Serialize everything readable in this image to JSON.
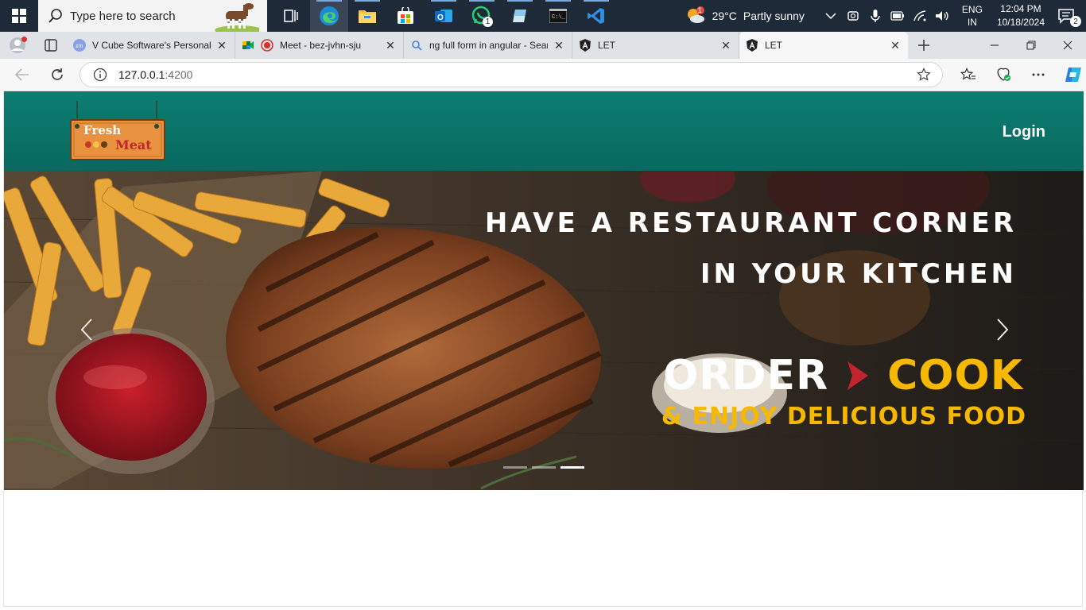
{
  "taskbar": {
    "search_placeholder": "Type here to search",
    "whatsapp_badge": "1",
    "weather_badge": "1",
    "weather_temp": "29°C",
    "weather_desc": "Partly sunny",
    "lang_line1": "ENG",
    "lang_line2": "IN",
    "time": "12:04 PM",
    "date": "10/18/2024",
    "notifications_count": "2"
  },
  "tabs": [
    {
      "title": "V Cube Software's Personal M",
      "icon": "zoom-icon"
    },
    {
      "title": "Meet - bez-jvhn-sju",
      "icon": "meet-icon"
    },
    {
      "title": "ng full form in angular - Sear",
      "icon": "search-icon"
    },
    {
      "title": "LET",
      "icon": "angular-icon"
    },
    {
      "title": "LET",
      "icon": "angular-icon"
    }
  ],
  "address": {
    "host": "127.0.0.1",
    "port": ":4200"
  },
  "site": {
    "brand_colors": {
      "navbar": "#0c7d71",
      "accent": "#f6b800",
      "arrow": "#c0252f"
    },
    "logo_line1": "Fresh",
    "logo_line2": "Meat",
    "login_label": "Login",
    "hero": {
      "line1": "HAVE A RESTAURANT CORNER",
      "line2": "IN YOUR KITCHEN",
      "order": "ORDER",
      "cook": "COOK",
      "enjoy": "& ENJOY DELICIOUS FOOD"
    },
    "carousel": {
      "slides": 3,
      "active_slide": 3
    }
  }
}
